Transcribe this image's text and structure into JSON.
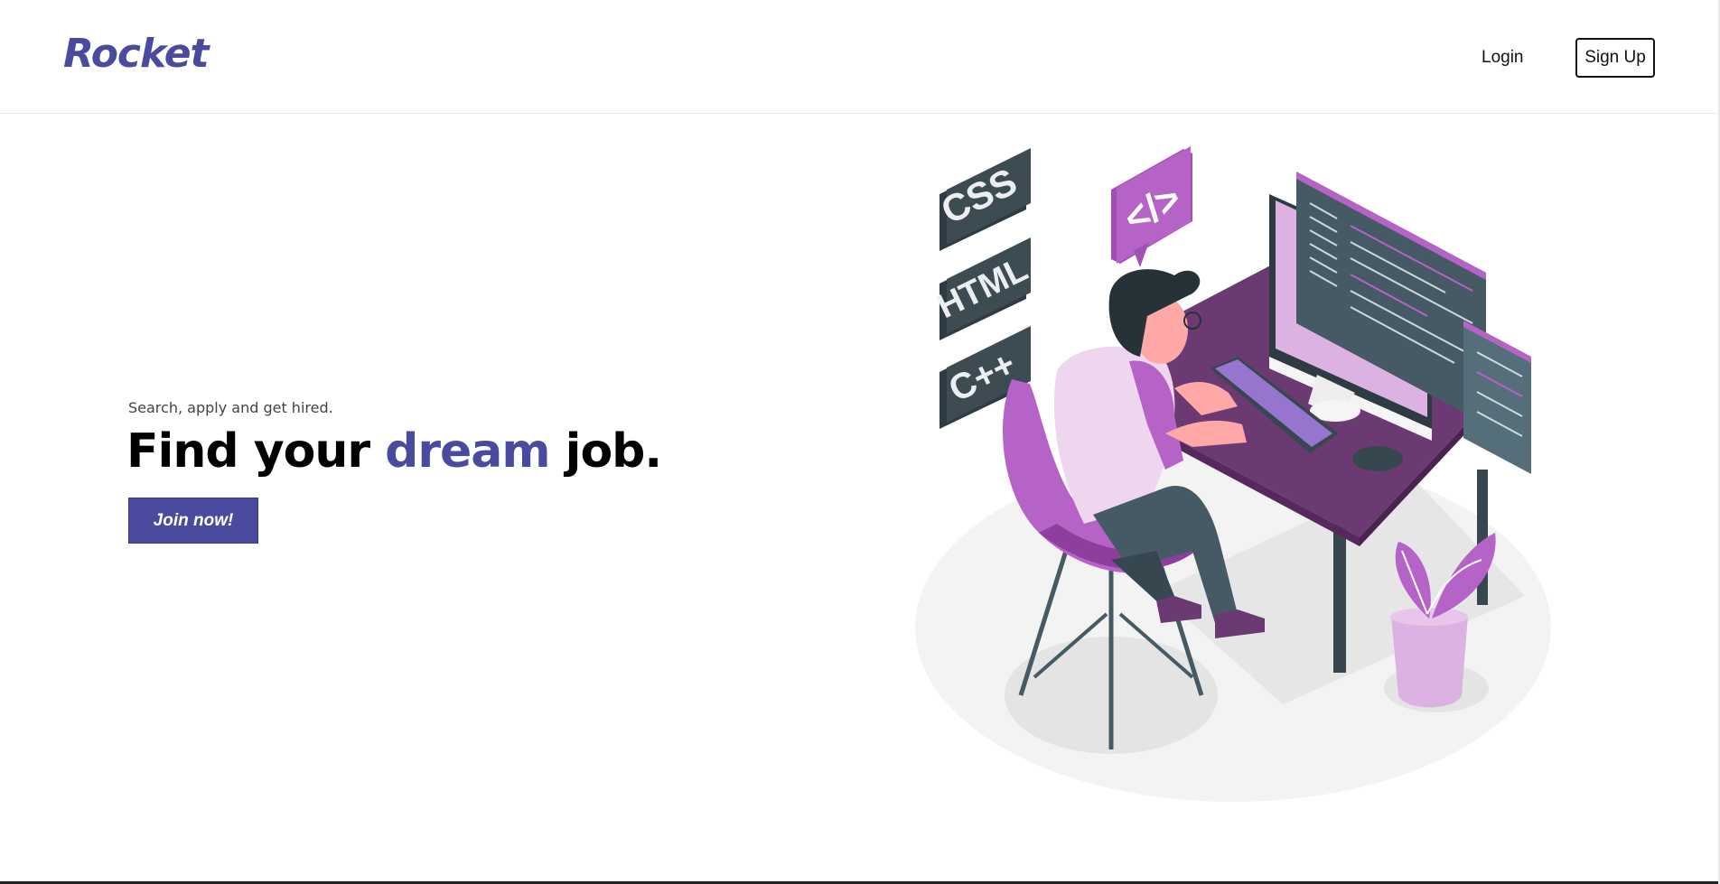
{
  "header": {
    "logo": "Rocket",
    "login_label": "Login",
    "signup_label": "Sign Up"
  },
  "hero": {
    "tagline": "Search, apply and get hired.",
    "headline_before": "Find your ",
    "headline_accent": "dream",
    "headline_after": " job.",
    "cta_label": "Join now!"
  },
  "illustration": {
    "tiles": [
      "CSS",
      "HTML",
      "C++"
    ],
    "code_badge": "</>"
  },
  "colors": {
    "brand": "#4a4a9e",
    "purple": "#b563c7",
    "light_purple": "#dcb2e2",
    "dark_slate": "#37474f",
    "desk": "#6c3a73"
  }
}
